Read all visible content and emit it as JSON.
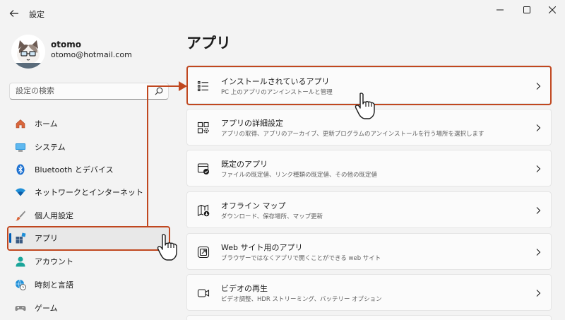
{
  "window": {
    "title": "設定"
  },
  "user": {
    "name": "otomo",
    "email": "otomo@hotmail.com"
  },
  "search": {
    "placeholder": "設定の検索"
  },
  "nav": {
    "items": [
      {
        "label": "ホーム",
        "icon": "home-icon"
      },
      {
        "label": "システム",
        "icon": "system-monitor-icon"
      },
      {
        "label": "Bluetooth とデバイス",
        "icon": "bluetooth-icon"
      },
      {
        "label": "ネットワークとインターネット",
        "icon": "wifi-icon"
      },
      {
        "label": "個人用設定",
        "icon": "brush-icon"
      },
      {
        "label": "アプリ",
        "icon": "apps-icon",
        "active": true
      },
      {
        "label": "アカウント",
        "icon": "account-icon"
      },
      {
        "label": "時刻と言語",
        "icon": "globe-clock-icon"
      },
      {
        "label": "ゲーム",
        "icon": "gamepad-icon"
      }
    ]
  },
  "main": {
    "heading": "アプリ",
    "cards": [
      {
        "title": "インストールされているアプリ",
        "desc": "PC 上のアプリのアンインストールと管理",
        "icon": "list-icon"
      },
      {
        "title": "アプリの詳細設定",
        "desc": "アプリの取得、アプリのアーカイブ、更新プログラムのアンインストールを行う場所を選択します",
        "icon": "app-settings-icon"
      },
      {
        "title": "既定のアプリ",
        "desc": "ファイルの既定値、リンク種類の既定値、その他の既定値",
        "icon": "default-apps-icon"
      },
      {
        "title": "オフライン マップ",
        "desc": "ダウンロード、保存場所、マップ更新",
        "icon": "offline-map-icon"
      },
      {
        "title": "Web サイト用のアプリ",
        "desc": "ブラウザーではなくアプリで開くことができる web サイト",
        "icon": "open-in-app-icon"
      },
      {
        "title": "ビデオの再生",
        "desc": "ビデオ調整、HDR ストリーミング、バッテリー オプション",
        "icon": "video-icon"
      }
    ]
  },
  "colors": {
    "highlight": "#c0471f",
    "accent": "#005fb8",
    "background": "#f3f3f3"
  }
}
